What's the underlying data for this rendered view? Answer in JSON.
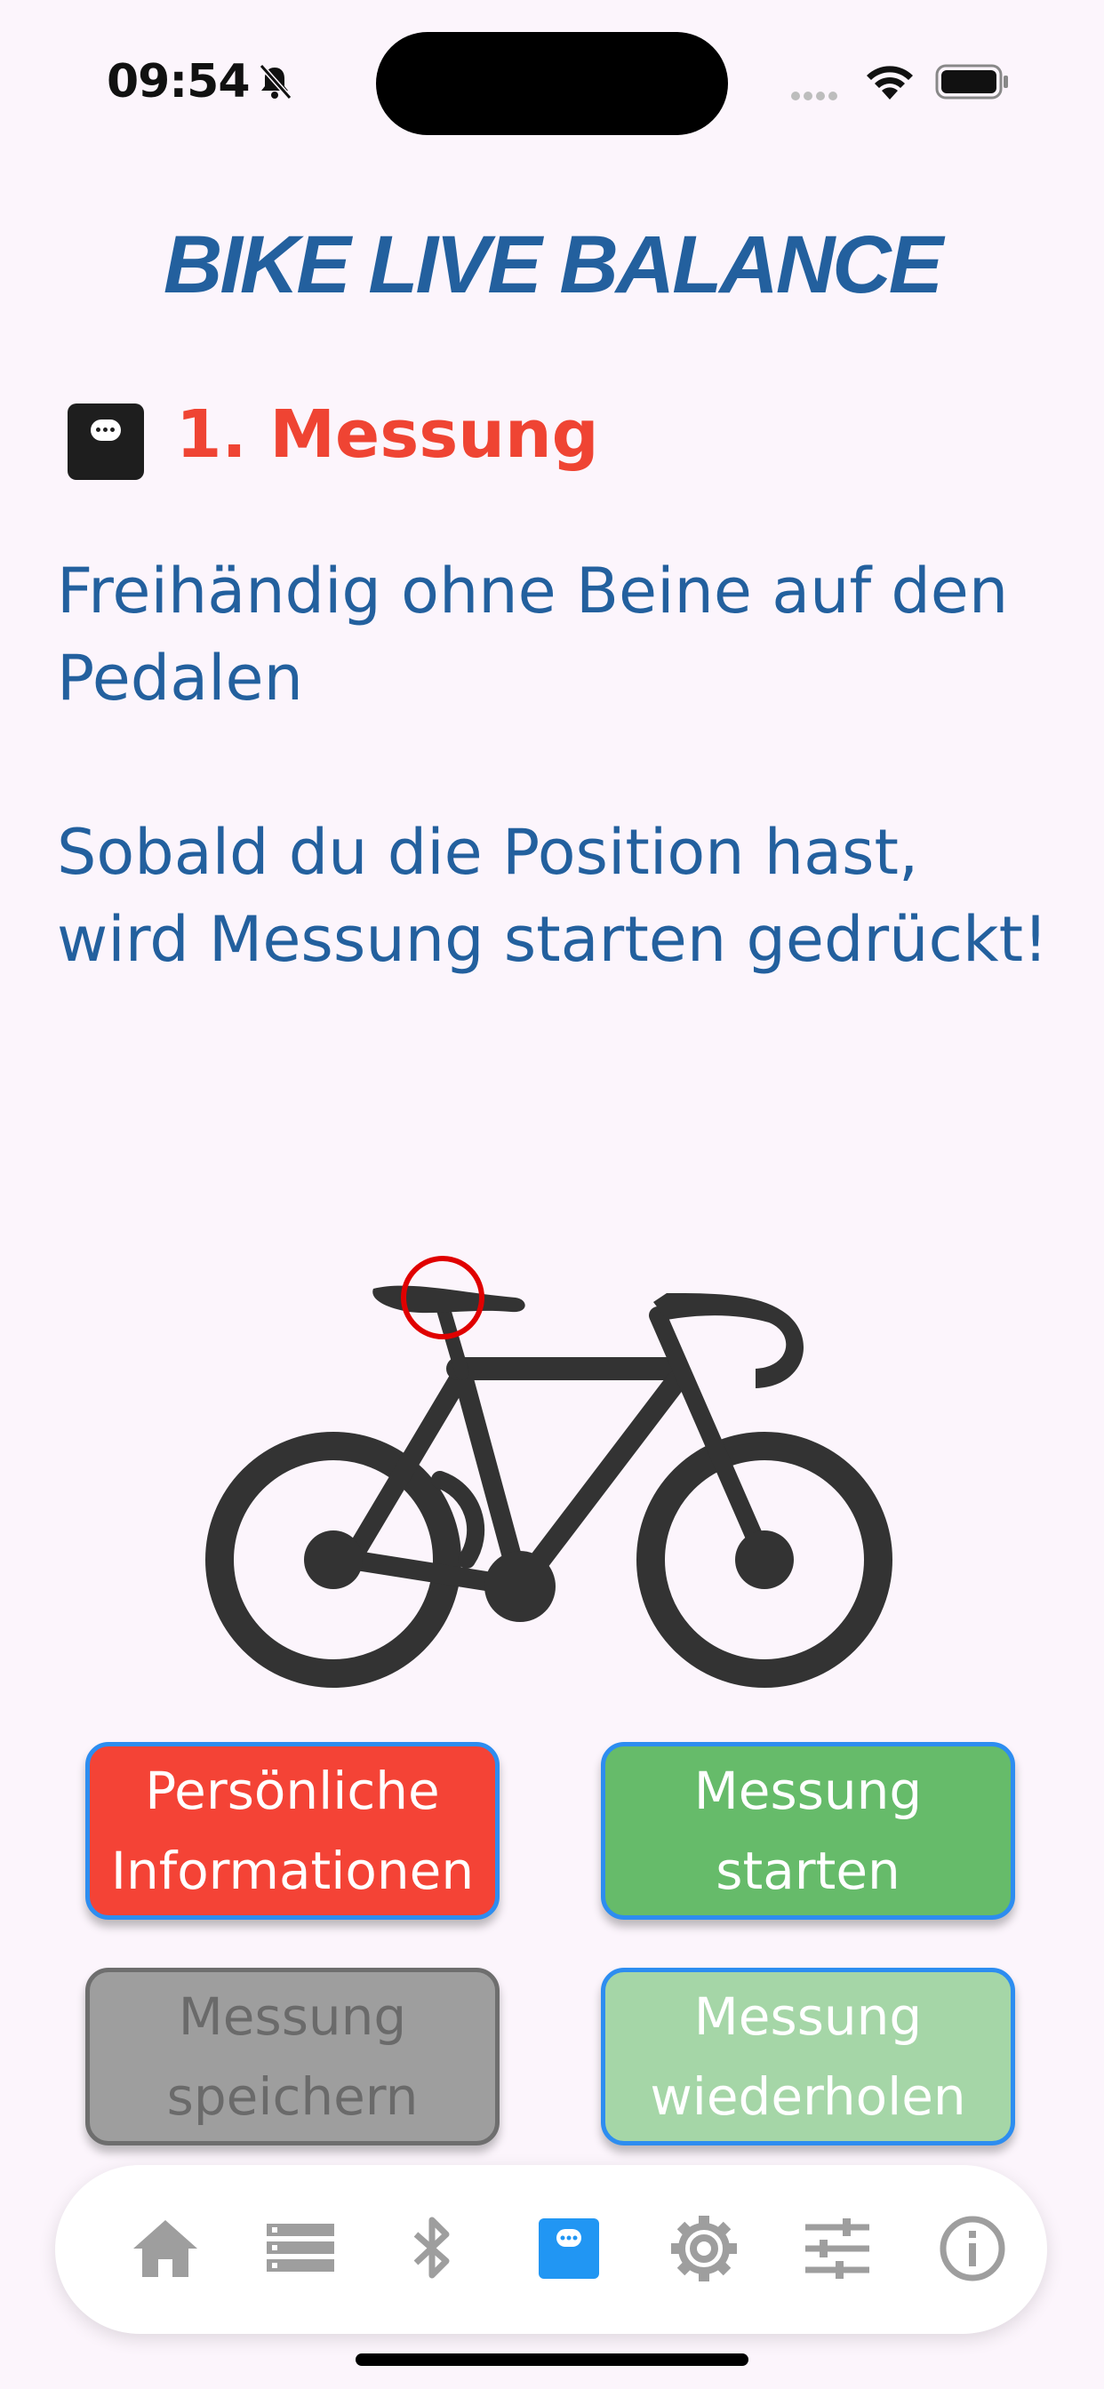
{
  "status_bar": {
    "time": "09:54"
  },
  "header": {
    "app_title": "BIKE LIVE BALANCE"
  },
  "step": {
    "title": "1. Messung",
    "instruction_1": "Freihändig ohne Beine auf den Pedalen",
    "instruction_2": "Sobald du die Position hast, wird Messung starten gedrückt!"
  },
  "buttons": {
    "personal_info": "Persönliche Informationen",
    "start_measurement": "Messung starten",
    "save_measurement": "Messung speichern",
    "repeat_measurement": "Messung wiederholen"
  },
  "colors": {
    "title_blue": "#23609e",
    "step_red": "#ef4433",
    "active_nav": "#2196f3",
    "inactive_nav": "#9e9e9e"
  },
  "nav": {
    "items": [
      {
        "icon": "home-icon",
        "active": false
      },
      {
        "icon": "list-icon",
        "active": false
      },
      {
        "icon": "bluetooth-icon",
        "active": false
      },
      {
        "icon": "scale-icon",
        "active": true
      },
      {
        "icon": "gear-icon",
        "active": false
      },
      {
        "icon": "sliders-icon",
        "active": false
      },
      {
        "icon": "info-icon",
        "active": false
      }
    ]
  }
}
